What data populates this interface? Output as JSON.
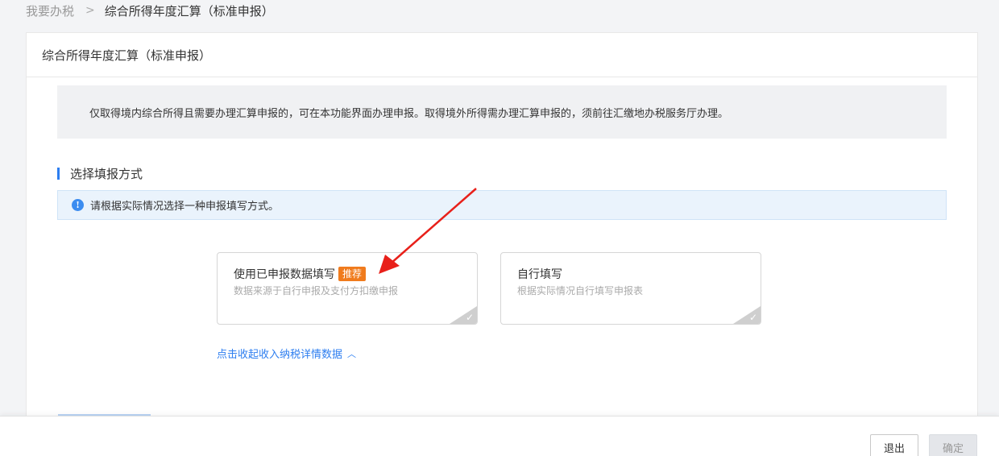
{
  "breadcrumb": {
    "parent": "我要办税",
    "separator": ">",
    "current": "综合所得年度汇算（标准申报）"
  },
  "card": {
    "title": "综合所得年度汇算（标准申报）",
    "notice": "仅取得境内综合所得且需要办理汇算申报的，可在本功能界面办理申报。取得境外所得需办理汇算申报的，须前往汇缴地办税服务厅办理。"
  },
  "section": {
    "title": "选择填报方式",
    "info_icon": "!",
    "info_text": "请根据实际情况选择一种申报填写方式。"
  },
  "options": [
    {
      "title": "使用已申报数据填写",
      "badge": "推荐",
      "desc": "数据来源于自行申报及支付方扣缴申报",
      "check": "✓"
    },
    {
      "title": "自行填写",
      "desc": "根据实际情况自行填写申报表",
      "check": "✓"
    }
  ],
  "collapse_link": {
    "label": "点击收起收入纳税详情数据",
    "icon": "chevron-up-icon",
    "glyph": "︿"
  },
  "footer": {
    "exit_label": "退出",
    "confirm_label": "确定"
  },
  "colors": {
    "accent": "#2d7ef0",
    "badge": "#f07b1d",
    "annotation_arrow": "#e8201a"
  }
}
